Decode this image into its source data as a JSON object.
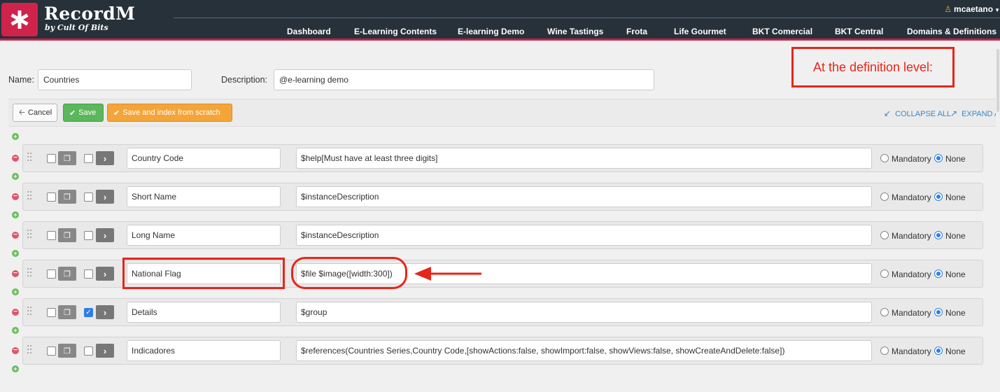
{
  "header": {
    "brand_name": "RecordM",
    "brand_sub": "by Cult Of Bits",
    "user": "mcaetano",
    "nav": [
      "Dashboard",
      "E-Learning Contents",
      "E-learning Demo",
      "Wine Tastings",
      "Frota",
      "Life Gourmet",
      "BKT Comercial",
      "BKT Central",
      "Domains & Definitions"
    ]
  },
  "form": {
    "name_label": "Name:",
    "name_value": "Countries",
    "description_label": "Description:",
    "description_value": "@e-learning demo"
  },
  "callout": "At the definition level:",
  "toolbar": {
    "cancel": "Cancel",
    "save": "Save",
    "save_index": "Save and index from scratch",
    "collapse_all": "COLLAPSE ALL",
    "expand_all": "EXPAND AL"
  },
  "fields": [
    {
      "name": "Country Code",
      "description": "$help[Must have at least three digits]",
      "checked": false,
      "mandatory": false
    },
    {
      "name": "Short Name",
      "description": "$instanceDescription",
      "checked": false,
      "mandatory": false
    },
    {
      "name": "Long Name",
      "description": "$instanceDescription",
      "checked": false,
      "mandatory": false
    },
    {
      "name": "National Flag",
      "description": "$file $image([width:300])",
      "checked": false,
      "mandatory": false
    },
    {
      "name": "Details",
      "description": "$group",
      "checked": true,
      "mandatory": false
    },
    {
      "name": "Indicadores",
      "description": "$references(Countries Series,Country Code,[showActions:false, showImport:false, showViews:false, showCreateAndDelete:false])",
      "checked": false,
      "mandatory": false
    }
  ],
  "radio_labels": {
    "mandatory": "Mandatory",
    "none": "None"
  },
  "colors": {
    "header_bg": "#26313a",
    "brand_red": "#d0234c",
    "annotation_red": "#e8251a",
    "accent_blue": "#2f7ee6"
  }
}
